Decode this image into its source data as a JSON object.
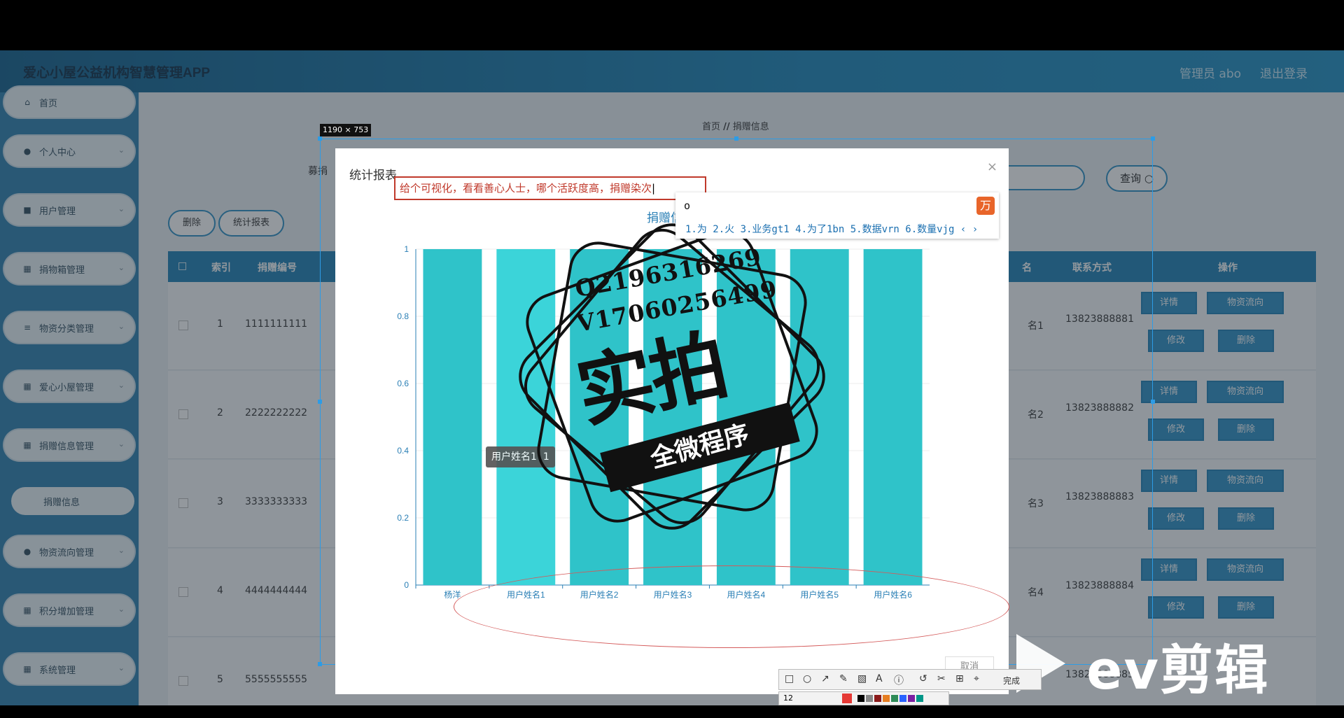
{
  "app": {
    "title": "爱心小屋公益机构智慧管理APP",
    "admin": "管理员 abo",
    "logout": "退出登录"
  },
  "sidebar": {
    "items": [
      {
        "label": "首页",
        "icon": "home-icon"
      },
      {
        "label": "个人中心",
        "icon": "user-icon"
      },
      {
        "label": "用户管理",
        "icon": "checkbox-icon"
      },
      {
        "label": "捐物箱管理",
        "icon": "grid-icon"
      },
      {
        "label": "物资分类管理",
        "icon": "list-icon"
      },
      {
        "label": "爱心小屋管理",
        "icon": "grid-icon"
      },
      {
        "label": "捐赠信息管理",
        "icon": "grid-icon"
      },
      {
        "label": "物资流向管理",
        "icon": "pin-icon"
      },
      {
        "label": "积分增加管理",
        "icon": "grid-icon"
      },
      {
        "label": "系统管理",
        "icon": "grid-icon"
      }
    ],
    "subitem": "捐赠信息"
  },
  "breadcrumb": {
    "home": "首页",
    "sep": "//",
    "current": "捐赠信息"
  },
  "search": {
    "label": "募捐",
    "button": "查询"
  },
  "toolbar": {
    "delete": "删除",
    "stats": "统计报表"
  },
  "table": {
    "headers": [
      "索引",
      "捐赠编号",
      "名",
      "联系方式",
      "操作"
    ],
    "rows": [
      {
        "index": "1",
        "code": "1111111111",
        "phone": "13823888881",
        "name_suffix": "名1"
      },
      {
        "index": "2",
        "code": "2222222222",
        "phone": "13823888882",
        "name_suffix": "名2"
      },
      {
        "index": "3",
        "code": "3333333333",
        "phone": "13823888883",
        "name_suffix": "名3"
      },
      {
        "index": "4",
        "code": "4444444444",
        "phone": "13823888884",
        "name_suffix": "名4"
      },
      {
        "index": "5",
        "code": "5555555555",
        "phone": "13823888885",
        "name_suffix": ""
      }
    ],
    "row_buttons": {
      "detail": "详情",
      "flow": "物资流向",
      "edit": "修改",
      "delete": "删除"
    }
  },
  "snip": {
    "size": "1190 × 753",
    "done": "完成",
    "font_size": "12"
  },
  "dialog": {
    "title": "统计报表",
    "close": "×",
    "annotation": "给个可视化，看看善心人士，哪个活跃度高，捐赠染次",
    "footer_btn": "取消"
  },
  "ime": {
    "input": "o",
    "candidates": "1.为 2.火 3.业务gt1 4.为了1bn 5.数据vrn 6.数量vjg"
  },
  "tooltip": {
    "name": "用户姓名1",
    "value": "1"
  },
  "watermark": {
    "qq": "Q2196316269",
    "wx": "V17060256499",
    "big": "实拍",
    "banner": "全微程序",
    "ev": "ev剪辑"
  },
  "chart_data": {
    "type": "bar",
    "title": "捐赠信",
    "categories": [
      "杨洋",
      "用户姓名1",
      "用户姓名2",
      "用户姓名3",
      "用户姓名4",
      "用户姓名5",
      "用户姓名6"
    ],
    "values": [
      1,
      1,
      1,
      1,
      1,
      1,
      1
    ],
    "yticks": [
      "0",
      "0.2",
      "0.4",
      "0.6",
      "0.8",
      "1"
    ],
    "ylim": [
      0,
      1
    ],
    "bar_color": "#2fc3c9",
    "highlight_color": "#3bd4d9"
  }
}
